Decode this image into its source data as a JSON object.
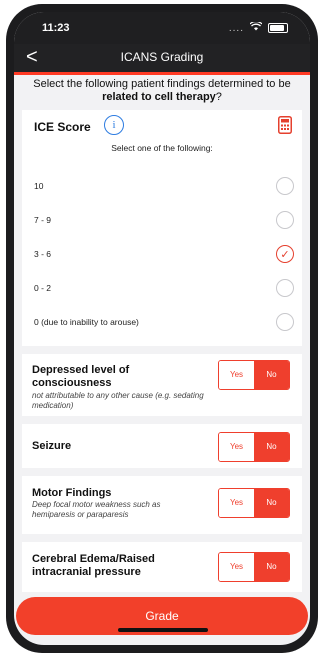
{
  "status": {
    "time": "11:23",
    "signal": "...."
  },
  "nav": {
    "back": "<",
    "title": "ICANS Grading"
  },
  "instructions": {
    "prefix": "Select the following patient findings determined to be",
    "bold": "related to cell therapy",
    "suffix": "?"
  },
  "ice": {
    "title": "ICE Score",
    "info_icon": "i",
    "hint": "Select one of the following:",
    "options": [
      {
        "label": "10",
        "checked": false
      },
      {
        "label": "7 - 9",
        "checked": false
      },
      {
        "label": "3 - 6",
        "checked": true
      },
      {
        "label": "0 - 2",
        "checked": false
      },
      {
        "label": "0 (due to inability to arouse)",
        "checked": false
      }
    ]
  },
  "findings": [
    {
      "title": "Depressed level of consciousness",
      "subtitle": "not attributable to any other cause (e.g. sedating medication)",
      "yes": "Yes",
      "no": "No",
      "selected": "No"
    },
    {
      "title": "Seizure",
      "subtitle": "",
      "yes": "Yes",
      "no": "No",
      "selected": "No"
    },
    {
      "title": "Motor Findings",
      "subtitle": "Deep focal motor weakness such as hemiparesis or paraparesis",
      "yes": "Yes",
      "no": "No",
      "selected": "No"
    },
    {
      "title": "Cerebral Edema/Raised intracranial pressure",
      "subtitle": "",
      "yes": "Yes",
      "no": "No",
      "selected": "No"
    }
  ],
  "grade_button": "Grade",
  "colors": {
    "accent": "#ef3f2d",
    "info": "#2f7de1"
  }
}
